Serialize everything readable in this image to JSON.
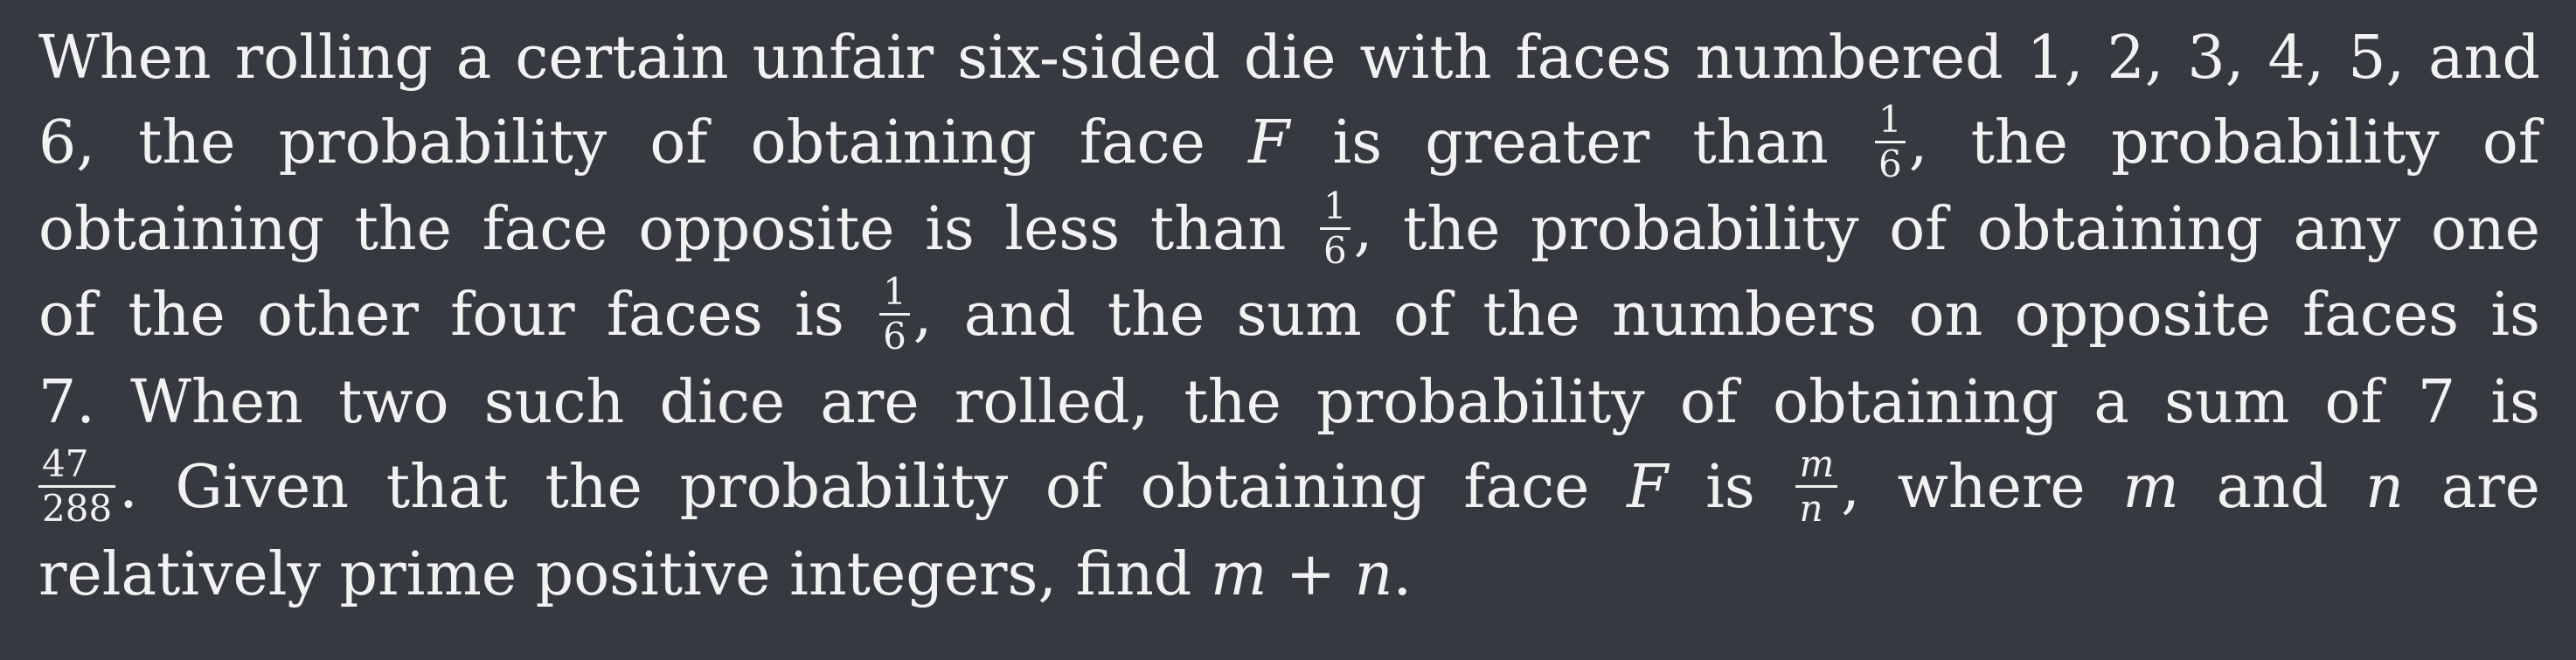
{
  "problem": {
    "line1": {
      "text_a": "When rolling a certain unfair six-sided die with faces numbered 1, 2, 3, 4, 5, and"
    },
    "line2": {
      "text_a": "6, the probability of obtaining face ",
      "var_F": "F",
      "text_b": " is greater than ",
      "frac_num": "1",
      "frac_den": "6",
      "text_c": ", the probability of"
    },
    "line3": {
      "text_a": "obtaining the face opposite is less than ",
      "frac_num": "1",
      "frac_den": "6",
      "text_b": ", the probability of obtaining any one"
    },
    "line4": {
      "text_a": "of the other four faces is ",
      "frac_num": "1",
      "frac_den": "6",
      "text_b": ", and the sum of the numbers on opposite faces is"
    },
    "line5": {
      "text_a": "7. When two such dice are rolled, the probability of obtaining a sum of 7 is"
    },
    "line6": {
      "frac_num": "47",
      "frac_den": "288",
      "text_a": ". Given that the probability of obtaining face ",
      "var_F": "F",
      "text_b": " is ",
      "frac2_num": "m",
      "frac2_den": "n",
      "text_c": ", where ",
      "var_m": "m",
      "text_d": " and ",
      "var_n": "n",
      "text_e": " are"
    },
    "line7": {
      "text_a": "relatively prime positive integers, find ",
      "var_m": "m",
      "op_plus": " + ",
      "var_n": "n",
      "text_b": "."
    }
  }
}
